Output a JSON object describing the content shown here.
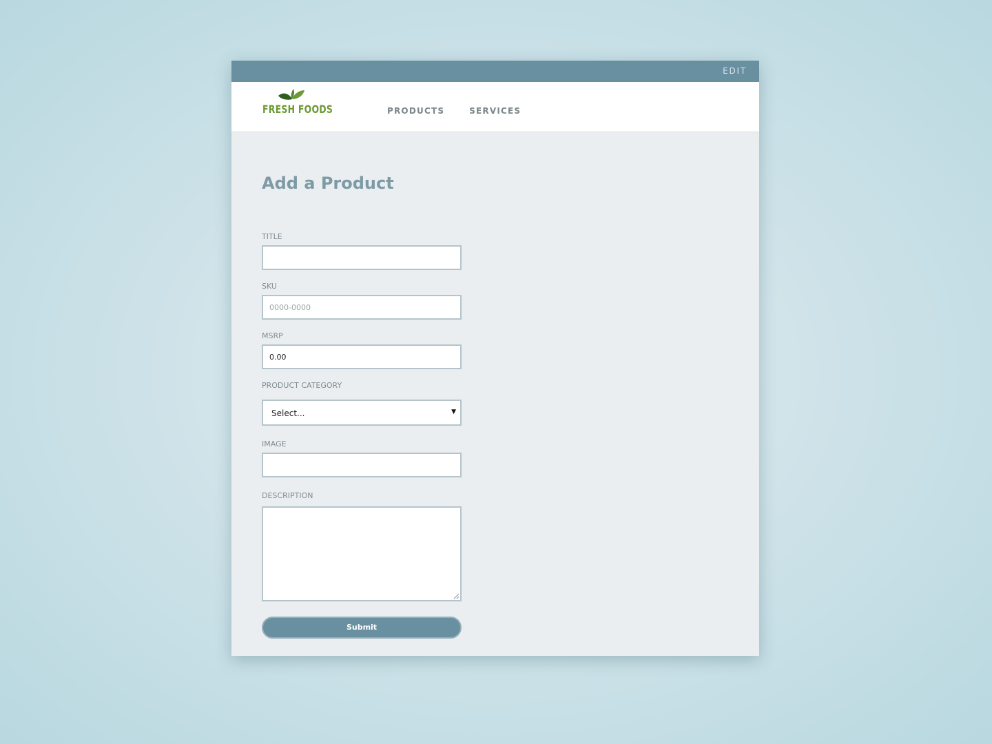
{
  "topbar": {
    "edit_label": "EDIT"
  },
  "brand": {
    "name": "FRESH FOODS",
    "color": "#6c9a35",
    "icon": "leaves-icon"
  },
  "nav": {
    "items": [
      {
        "label": "PRODUCTS"
      },
      {
        "label": "SERVICES"
      }
    ]
  },
  "page": {
    "title": "Add a Product"
  },
  "form": {
    "title_label": "TITLE",
    "title_value": "",
    "sku_label": "SKU",
    "sku_placeholder": "0000-0000",
    "msrp_label": "MSRP",
    "msrp_value": "0.00",
    "category_label": "PRODUCT CATEGORY",
    "category_value": "Select...",
    "image_label": "IMAGE",
    "image_value": "",
    "description_label": "DESCRIPTION",
    "submit_label": "Submit"
  },
  "colors": {
    "accent": "#6890a0",
    "title": "#7d9aa5",
    "background_panel": "#eaeef1"
  }
}
